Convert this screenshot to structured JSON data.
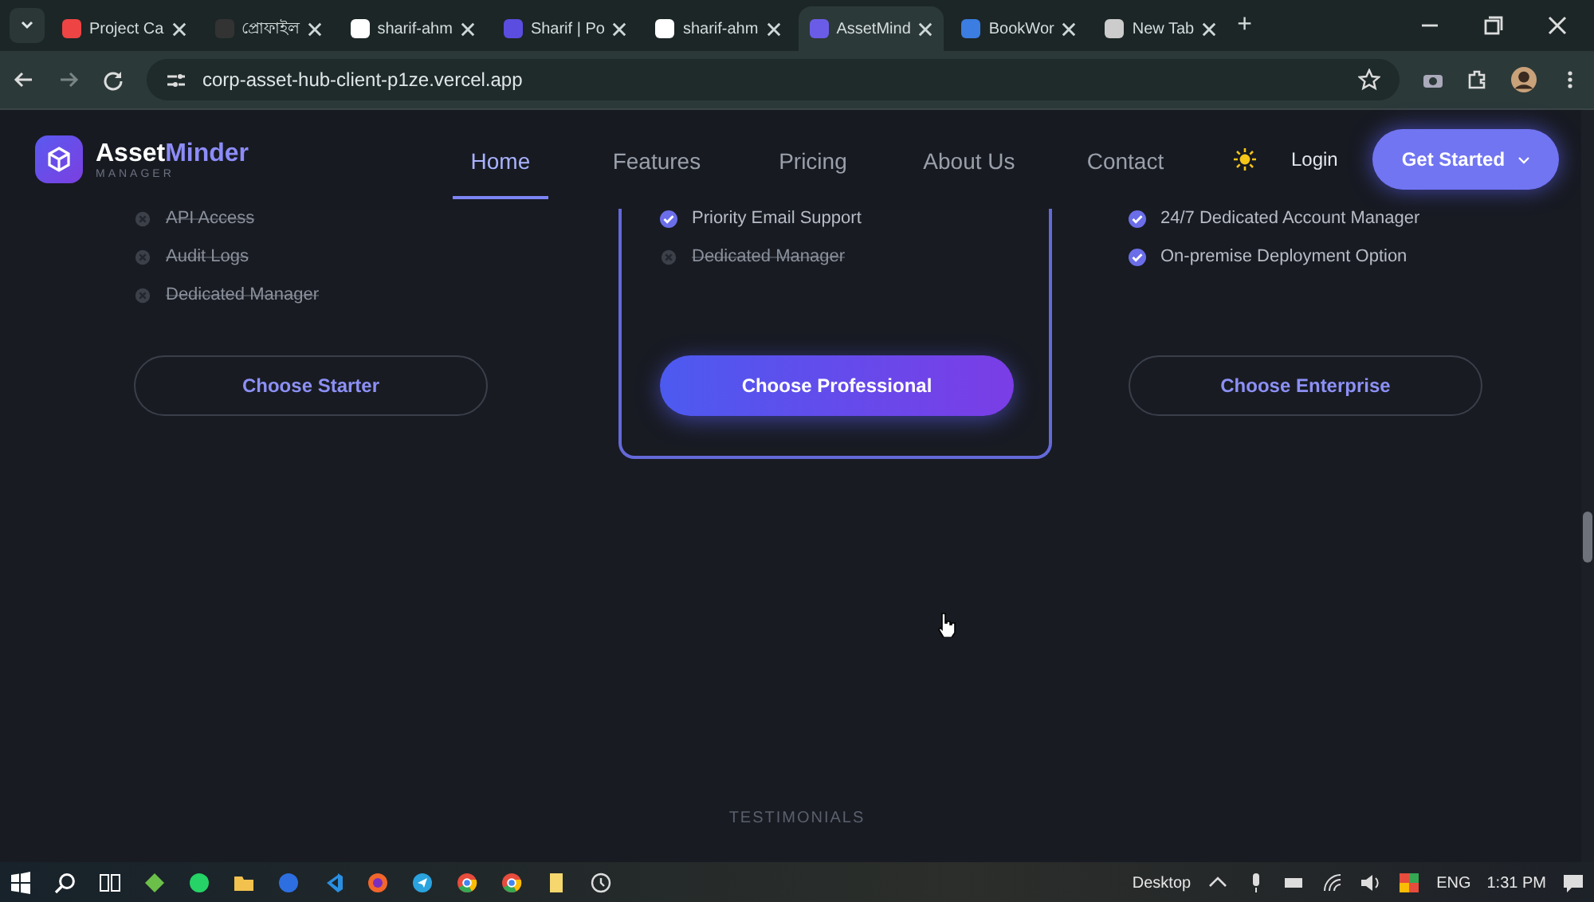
{
  "browser": {
    "tabs": [
      {
        "title": "Project Ca",
        "selected": false
      },
      {
        "title": "প্রোফাইল",
        "selected": false
      },
      {
        "title": "sharif-ahm",
        "selected": false
      },
      {
        "title": "Sharif | Po",
        "selected": false
      },
      {
        "title": "sharif-ahm",
        "selected": false
      },
      {
        "title": "AssetMind",
        "selected": true
      },
      {
        "title": "BookWor",
        "selected": false
      },
      {
        "title": "New Tab",
        "selected": false
      }
    ],
    "new_tab": "+",
    "address": "corp-asset-hub-client-p1ze.vercel.app"
  },
  "site": {
    "brand": {
      "name_main": "Asset",
      "name_accent": "Minder",
      "tagline": "MANAGER"
    },
    "nav": [
      {
        "label": "Home",
        "selected": true
      },
      {
        "label": "Features",
        "selected": false
      },
      {
        "label": "Pricing",
        "selected": false
      },
      {
        "label": "About Us",
        "selected": false
      },
      {
        "label": "Contact",
        "selected": false
      }
    ],
    "login": "Login",
    "cta": "Get Started"
  },
  "plans": [
    {
      "featured": false,
      "features": [
        {
          "text": "API Access",
          "included": false
        },
        {
          "text": "Audit Logs",
          "included": false
        },
        {
          "text": "Dedicated Manager",
          "included": false
        }
      ],
      "button": "Choose Starter"
    },
    {
      "featured": true,
      "features": [
        {
          "text": "Priority Email Support",
          "included": true
        },
        {
          "text": "Dedicated Manager",
          "included": false
        }
      ],
      "button": "Choose Professional"
    },
    {
      "featured": false,
      "features": [
        {
          "text": "24/7 Dedicated Account Manager",
          "included": true
        },
        {
          "text": "On-premise Deployment Option",
          "included": true
        }
      ],
      "button": "Choose Enterprise"
    }
  ],
  "section_heading": "TESTIMONIALS",
  "taskbar": {
    "desktop": "Desktop",
    "language": "ENG",
    "time": "1:31 PM"
  }
}
